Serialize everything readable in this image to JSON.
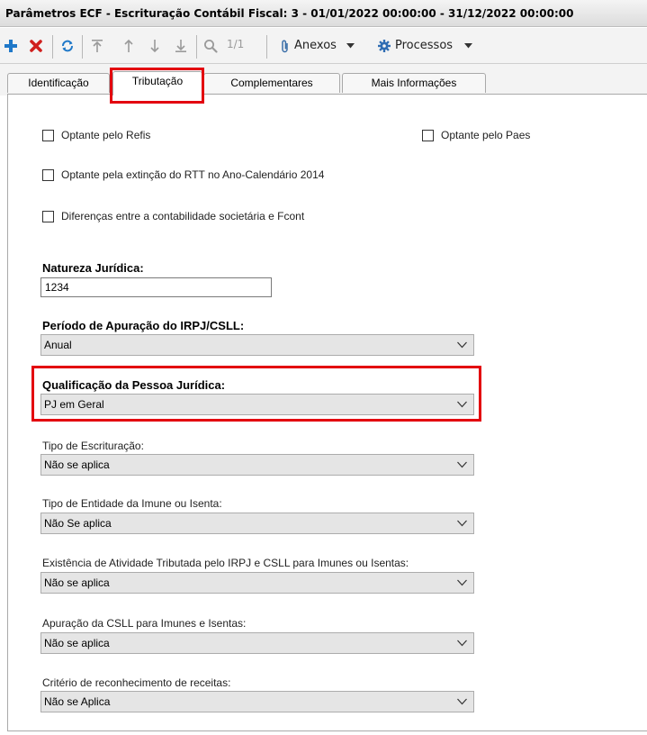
{
  "window": {
    "title": "Parâmetros ECF - Escrituração Contábil Fiscal: 3 - 01/01/2022 00:00:00 - 31/12/2022 00:00:00"
  },
  "toolbar": {
    "page_count": "1/1",
    "anexos_label": "Anexos",
    "processos_label": "Processos",
    "icons": [
      "add-icon",
      "delete-icon",
      "refresh-icon",
      "first-record-icon",
      "previous-record-icon",
      "next-record-icon",
      "last-record-icon",
      "search-icon",
      "paperclip-icon",
      "caret-down-icon",
      "gear-icon",
      "caret-down-icon"
    ]
  },
  "tabs": [
    {
      "label": "Identificação",
      "active": false
    },
    {
      "label": "Tributação",
      "active": true
    },
    {
      "label": "Complementares",
      "active": false
    },
    {
      "label": "Mais Informações",
      "active": false
    }
  ],
  "form": {
    "checkboxes": {
      "refis": "Optante pelo Refis",
      "paes": "Optante pelo Paes",
      "rtt": "Optante pela extinção do RTT no Ano-Calendário 2014",
      "fcont": "Diferenças entre a contabilidade societária e Fcont"
    },
    "natureza": {
      "label": "Natureza Jurídica:",
      "value": "1234"
    },
    "periodo": {
      "label": "Período de Apuração do IRPJ/CSLL:",
      "value": "Anual"
    },
    "qualificacao": {
      "label": "Qualificação da Pessoa Jurídica:",
      "value": "PJ em Geral"
    },
    "tipo_escrituracao": {
      "label": "Tipo de Escrituração:",
      "value": "Não se aplica"
    },
    "tipo_entidade": {
      "label": "Tipo de Entidade da Imune ou Isenta:",
      "value": "Não Se aplica"
    },
    "existencia": {
      "label": "Existência de Atividade Tributada pelo IRPJ e CSLL para Imunes ou Isentas:",
      "value": "Não se aplica"
    },
    "apuracao_csll": {
      "label": "Apuração da CSLL para Imunes e Isentas:",
      "value": "Não se aplica"
    },
    "criterio": {
      "label": "Critério de reconhecimento de receitas:",
      "value": "Não se Aplica"
    }
  },
  "colors": {
    "highlight": "#e3000f",
    "add": "#1f78c8",
    "delete": "#d0201e"
  }
}
